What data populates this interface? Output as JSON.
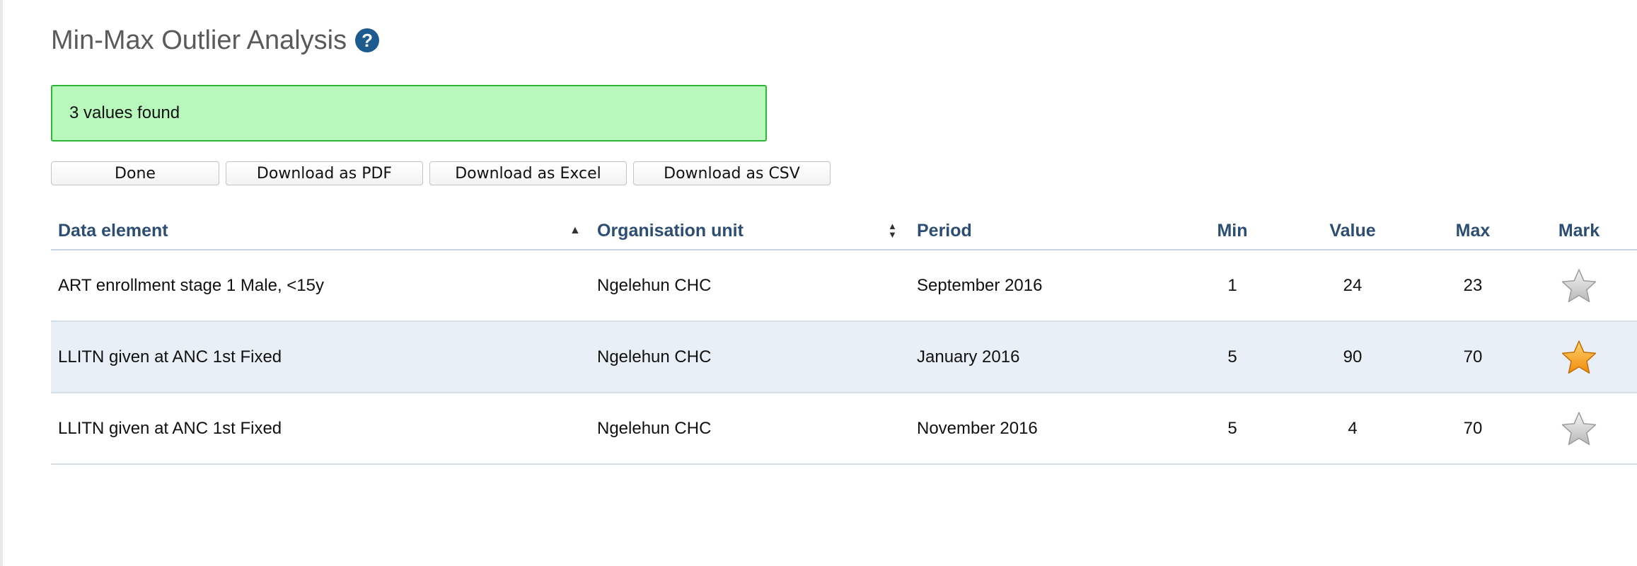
{
  "page": {
    "title": "Min-Max Outlier Analysis",
    "help_icon": "question-circle-icon"
  },
  "notice": {
    "text": "3 values found",
    "color": "#b8f8bc"
  },
  "toolbar": {
    "done_label": "Done",
    "pdf_label": "Download as PDF",
    "excel_label": "Download as Excel",
    "csv_label": "Download as CSV"
  },
  "table": {
    "headers": {
      "data_element": "Data element",
      "org_unit": "Organisation unit",
      "period": "Period",
      "min": "Min",
      "value": "Value",
      "max": "Max",
      "mark": "Mark"
    },
    "sort": {
      "data_element": "ascending",
      "org_unit": "unsorted"
    },
    "rows": [
      {
        "data_element": "ART enrollment stage 1 Male, <15y",
        "org_unit": "Ngelehun CHC",
        "period": "September 2016",
        "min": "1",
        "value": "24",
        "max": "23",
        "marked": false
      },
      {
        "data_element": "LLITN given at ANC 1st Fixed",
        "org_unit": "Ngelehun CHC",
        "period": "January 2016",
        "min": "5",
        "value": "90",
        "max": "70",
        "marked": true
      },
      {
        "data_element": "LLITN given at ANC 1st Fixed",
        "org_unit": "Ngelehun CHC",
        "period": "November 2016",
        "min": "5",
        "value": "4",
        "max": "70",
        "marked": false
      }
    ]
  },
  "colors": {
    "header_text": "#2d4e73",
    "alt_row": "#e9eff6",
    "star_marked": "#f7a21b",
    "star_unmarked": "#c8c8c8"
  }
}
